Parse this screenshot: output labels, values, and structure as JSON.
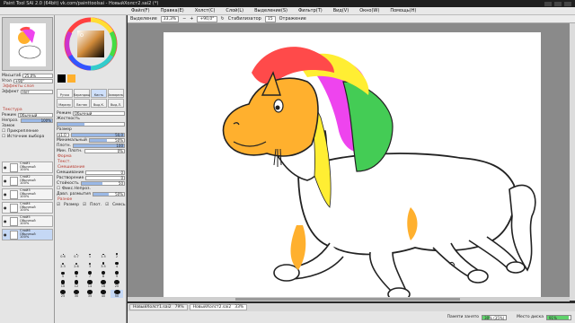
{
  "window": {
    "title": "Paint Tool SAI 2.0 (64bit) vk.com/painttoolsai - НовыйХолст2.sai2 (*)"
  },
  "menu": [
    "Файл(F)",
    "Правка(E)",
    "Холст(C)",
    "Слой(L)",
    "Выделение(S)",
    "Фильтр(T)",
    "Вид(V)",
    "Окно(W)",
    "Помощь(H)"
  ],
  "toolbar": {
    "selection_label": "Выделение",
    "zoom": "33,3%",
    "angle": "+90,0°",
    "stabilizer_label": "Стабилизатор",
    "stabilizer_value": "15",
    "mirror_label": "Отражение"
  },
  "left_panel": {
    "zoom_label": "Масштаб",
    "zoom_value": "25,0%",
    "angle_label": "Угол",
    "angle_value": "+90°",
    "layer_effects": "Эффекты слоя",
    "effect_label": "Эффект",
    "effect_value": "Нет",
    "texture_section": "Текстура",
    "mode_label": "Режим",
    "mode_value": "Обычный",
    "opacity_label": "Непроз.",
    "opacity_value": "100%",
    "lock_label": "Замок",
    "clip_label": "Прикрепление",
    "source_label": "Источник выбора",
    "layers": [
      {
        "name": "Слой1",
        "mode": "Обычный",
        "opacity": "100%"
      },
      {
        "name": "Слой2",
        "mode": "Обычный",
        "opacity": "100%"
      },
      {
        "name": "Слой3",
        "mode": "Обычный",
        "opacity": "100%"
      },
      {
        "name": "Слой4",
        "mode": "Обычный",
        "opacity": "100%"
      },
      {
        "name": "Слой5",
        "mode": "Обычный",
        "opacity": "100%"
      },
      {
        "name": "Слой6",
        "mode": "Обычный",
        "opacity": "100%"
      }
    ]
  },
  "tools": {
    "items": [
      "Ручка",
      "Карандаш",
      "Кисть",
      "Акварель",
      "Маркер",
      "Ластик",
      "Выд.К.",
      "Выд.Л."
    ],
    "selected_index": 2,
    "mode_label": "Режим",
    "mode_value": "Обычный",
    "hardness_label": "Жесткость",
    "size_label": "Размер",
    "size_multiplier": "x1.0",
    "size_value": "50,0",
    "min_size_label": "Минимальный",
    "min_size_value": "50%",
    "density_label": "Плотн.",
    "density_value": "100",
    "min_density_label": "Мин. Плотн.",
    "min_density_value": "0%",
    "shape_section": "Форма",
    "texture_section": "Текст.",
    "mixing_section": "Смешивание",
    "blend_label": "Смешивание",
    "blend_value": "0",
    "dilution_label": "Растворение",
    "dilution_value": "0",
    "persistence_label": "Стойкость",
    "persistence_value": "50",
    "keep_opacity_label": "Фикс.Непроз.",
    "blur_pressure_label": "Давл. размытия",
    "blur_pressure_value": "50%",
    "misc_section": "Разное",
    "check_size": "Размер",
    "check_density": "Плот.",
    "check_mix": "Смесь",
    "brush_sizes": [
      "0.6",
      "0.7",
      "1",
      "1.5",
      "2",
      "2.3",
      "2.6",
      "3",
      "3.5",
      "4",
      "5",
      "6",
      "7",
      "8",
      "9",
      "10",
      "12",
      "14",
      "16",
      "20",
      "25",
      "30",
      "35",
      "40",
      "50"
    ],
    "selected_brush_index": 24
  },
  "tabs": [
    {
      "name": "НовыйХолст1.sai2",
      "zoom": "79%"
    },
    {
      "name": "НовыйХолст2.sai2",
      "zoom": "33%"
    }
  ],
  "status": {
    "memory_label": "Памяти занято",
    "memory_value": "30% (35%)",
    "memory_fraction": 0.3,
    "disk_label": "Место диска",
    "disk_value": "91%",
    "disk_fraction": 0.91
  },
  "colors": {
    "accent_selection": "#c5d8f5",
    "mane_red": "#ff4a4a",
    "mane_yellow": "#ffee33",
    "mane_magenta": "#ee44ee",
    "mane_green": "#44cc55",
    "body_orange": "#ffb02e"
  }
}
